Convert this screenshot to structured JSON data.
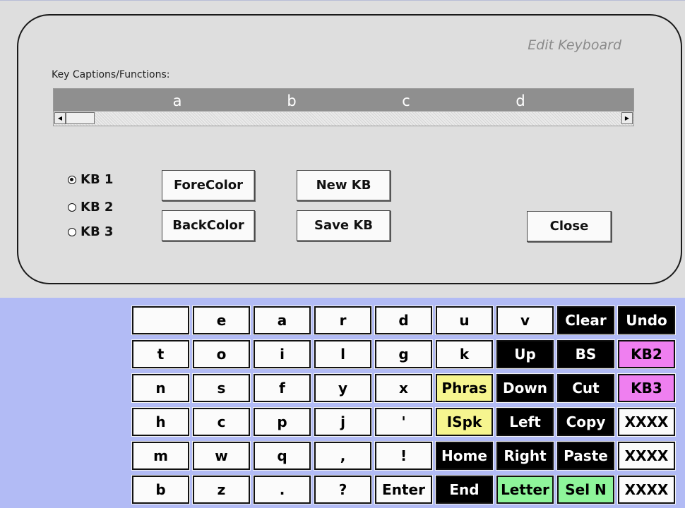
{
  "panel": {
    "title": "Edit Keyboard",
    "captions_label": "Key Captions/Functions:",
    "captions": [
      "a",
      "b",
      "c",
      "d"
    ]
  },
  "radios": [
    {
      "label": "KB 1",
      "checked": true
    },
    {
      "label": "KB 2",
      "checked": false
    },
    {
      "label": "KB 3",
      "checked": false
    }
  ],
  "buttons": {
    "forecolor": "ForeColor",
    "backcolor": "BackColor",
    "new_kb": "New KB",
    "save_kb": "Save KB",
    "close": "Close"
  },
  "colors": {
    "white_key": "#fbfbfb",
    "black_key": "#000000",
    "yellow_key": "#f6f58f",
    "pink_key": "#ef7ff0",
    "green_key": "#8ef59a",
    "keyboard_bg": "#b2bbf5"
  },
  "keyboard": {
    "rows": [
      [
        {
          "label": "",
          "style": "white"
        },
        {
          "label": "e",
          "style": "white"
        },
        {
          "label": "a",
          "style": "white"
        },
        {
          "label": "r",
          "style": "white"
        },
        {
          "label": "d",
          "style": "white"
        },
        {
          "label": "u",
          "style": "white"
        },
        {
          "label": "v",
          "style": "white"
        },
        {
          "label": "Clear",
          "style": "black"
        },
        {
          "label": "Undo",
          "style": "black"
        }
      ],
      [
        {
          "label": "t",
          "style": "white"
        },
        {
          "label": "o",
          "style": "white"
        },
        {
          "label": "i",
          "style": "white"
        },
        {
          "label": "l",
          "style": "white"
        },
        {
          "label": "g",
          "style": "white"
        },
        {
          "label": "k",
          "style": "white"
        },
        {
          "label": "Up",
          "style": "black"
        },
        {
          "label": "BS",
          "style": "black"
        },
        {
          "label": "KB2",
          "style": "pink"
        }
      ],
      [
        {
          "label": "n",
          "style": "white"
        },
        {
          "label": "s",
          "style": "white"
        },
        {
          "label": "f",
          "style": "white"
        },
        {
          "label": "y",
          "style": "white"
        },
        {
          "label": "x",
          "style": "white"
        },
        {
          "label": "Phras",
          "style": "yellow"
        },
        {
          "label": "Down",
          "style": "black"
        },
        {
          "label": "Cut",
          "style": "black"
        },
        {
          "label": "KB3",
          "style": "pink"
        }
      ],
      [
        {
          "label": "h",
          "style": "white"
        },
        {
          "label": "c",
          "style": "white"
        },
        {
          "label": "p",
          "style": "white"
        },
        {
          "label": "j",
          "style": "white"
        },
        {
          "label": "'",
          "style": "white"
        },
        {
          "label": "ISpk",
          "style": "yellow"
        },
        {
          "label": "Left",
          "style": "black"
        },
        {
          "label": "Copy",
          "style": "black"
        },
        {
          "label": "XXXX",
          "style": "white"
        }
      ],
      [
        {
          "label": "m",
          "style": "white"
        },
        {
          "label": "w",
          "style": "white"
        },
        {
          "label": "q",
          "style": "white"
        },
        {
          "label": ",",
          "style": "white"
        },
        {
          "label": "!",
          "style": "white"
        },
        {
          "label": "Home",
          "style": "black"
        },
        {
          "label": "Right",
          "style": "black"
        },
        {
          "label": "Paste",
          "style": "black"
        },
        {
          "label": "XXXX",
          "style": "white"
        }
      ],
      [
        {
          "label": "b",
          "style": "white"
        },
        {
          "label": "z",
          "style": "white"
        },
        {
          "label": ".",
          "style": "white"
        },
        {
          "label": "?",
          "style": "white"
        },
        {
          "label": "Enter",
          "style": "white"
        },
        {
          "label": "End",
          "style": "black"
        },
        {
          "label": "Letter",
          "style": "green"
        },
        {
          "label": "Sel N",
          "style": "green"
        },
        {
          "label": "XXXX",
          "style": "white"
        }
      ]
    ]
  }
}
